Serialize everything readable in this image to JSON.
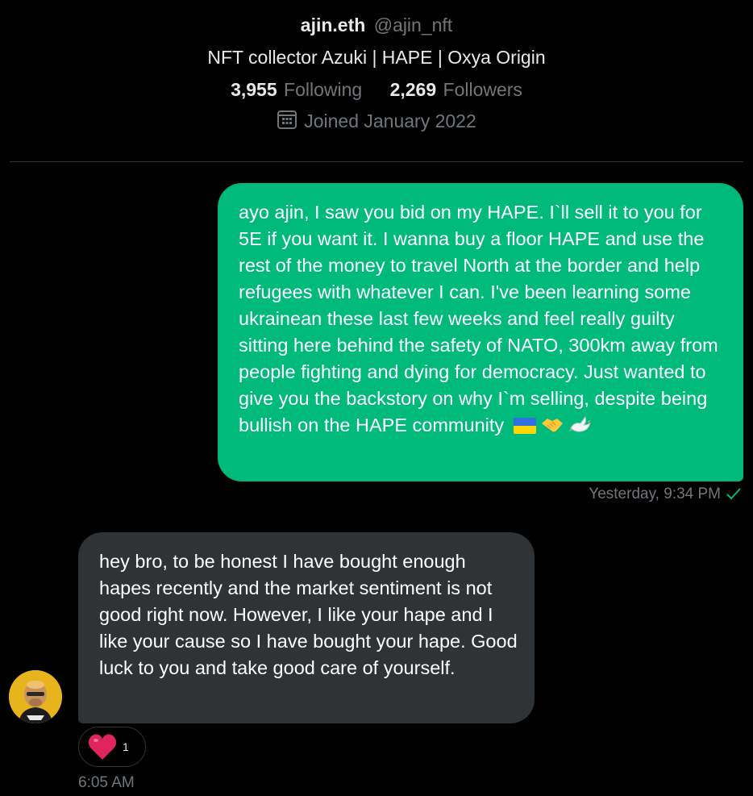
{
  "profile": {
    "display_name": "ajin.eth",
    "handle": "@ajin_nft",
    "bio": "NFT collector Azuki | HAPE | Oxya Origin",
    "following_count": "3,955",
    "following_label": "Following",
    "followers_count": "2,269",
    "followers_label": "Followers",
    "joined": "Joined January 2022"
  },
  "messages": {
    "outgoing": {
      "text": "ayo ajin, I saw you bid on my HAPE. I`ll sell it to you for 5E if you want it. I wanna buy a floor HAPE and use the rest of the money to travel North at the border and help refugees with whatever I can. I've been learning some ukrainean these last few weeks and feel really guilty sitting here behind the safety of NATO, 300km away from people fighting and dying for democracy. Just wanted to give you the backstory on why I`m selling, despite being bullish on the HAPE community",
      "timestamp": "Yesterday, 9:34 PM",
      "emojis": [
        "ukraine-flag-icon",
        "handshake-icon",
        "dove-icon"
      ]
    },
    "incoming": {
      "text": "hey bro, to be honest I have bought enough hapes recently and the market sentiment is not good right now. However, I like your hape and I like your cause so I have bought your hape. Good luck to you and take good care of yourself.",
      "timestamp": "6:05 AM",
      "reaction_count": "1"
    }
  },
  "colors": {
    "background": "#000000",
    "outgoing_bubble": "#00ba7c",
    "incoming_bubble": "#2f3336",
    "muted_text": "#71767b",
    "heart": "#f91880"
  }
}
